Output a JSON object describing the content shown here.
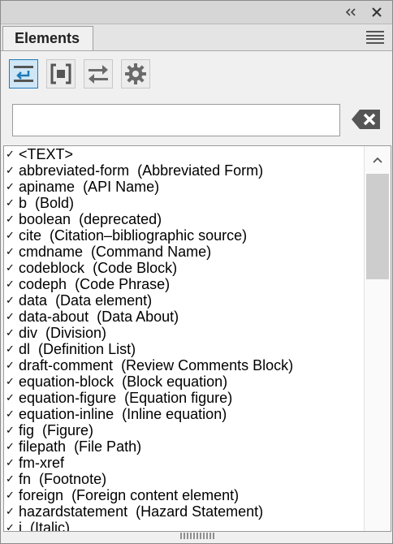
{
  "window": {
    "collapse_icon": "double-chevron-left-icon",
    "close_icon": "close-icon"
  },
  "tab": {
    "label": "Elements"
  },
  "panel_menu_icon": "hamburger-menu-icon",
  "toolbar": [
    {
      "icon": "elements-list-toggle-icon",
      "active": true
    },
    {
      "icon": "element-bracket-icon",
      "active": false
    },
    {
      "icon": "swap-arrows-icon",
      "active": false
    },
    {
      "icon": "settings-gear-icon",
      "active": false
    }
  ],
  "search": {
    "value": "",
    "clear_icon": "backspace-clear-icon"
  },
  "colors": {
    "active_border": "#1c7ab8",
    "active_fill": "#cfe6f6",
    "icon_gray": "#6a6a6a"
  },
  "elements": [
    {
      "name": "<TEXT>",
      "desc": ""
    },
    {
      "name": "abbreviated-form",
      "desc": "(Abbreviated Form)"
    },
    {
      "name": "apiname",
      "desc": "(API Name)"
    },
    {
      "name": "b",
      "desc": "(Bold)"
    },
    {
      "name": "boolean",
      "desc": "(deprecated)"
    },
    {
      "name": "cite",
      "desc": "(Citation–bibliographic source)"
    },
    {
      "name": "cmdname",
      "desc": "(Command Name)"
    },
    {
      "name": "codeblock",
      "desc": "(Code Block)"
    },
    {
      "name": "codeph",
      "desc": "(Code Phrase)"
    },
    {
      "name": "data",
      "desc": "(Data element)"
    },
    {
      "name": "data-about",
      "desc": "(Data About)"
    },
    {
      "name": "div",
      "desc": "(Division)"
    },
    {
      "name": "dl",
      "desc": "(Definition List)"
    },
    {
      "name": "draft-comment",
      "desc": "(Review Comments Block)"
    },
    {
      "name": "equation-block",
      "desc": "(Block equation)"
    },
    {
      "name": "equation-figure",
      "desc": "(Equation figure)"
    },
    {
      "name": "equation-inline",
      "desc": "(Inline equation)"
    },
    {
      "name": "fig",
      "desc": "(Figure)"
    },
    {
      "name": "filepath",
      "desc": "(File Path)"
    },
    {
      "name": "fm-xref",
      "desc": ""
    },
    {
      "name": "fn",
      "desc": "(Footnote)"
    },
    {
      "name": "foreign",
      "desc": "(Foreign content element)"
    },
    {
      "name": "hazardstatement",
      "desc": "(Hazard Statement)"
    },
    {
      "name": "i",
      "desc": "(Italic)"
    }
  ],
  "checkmark": "✓"
}
